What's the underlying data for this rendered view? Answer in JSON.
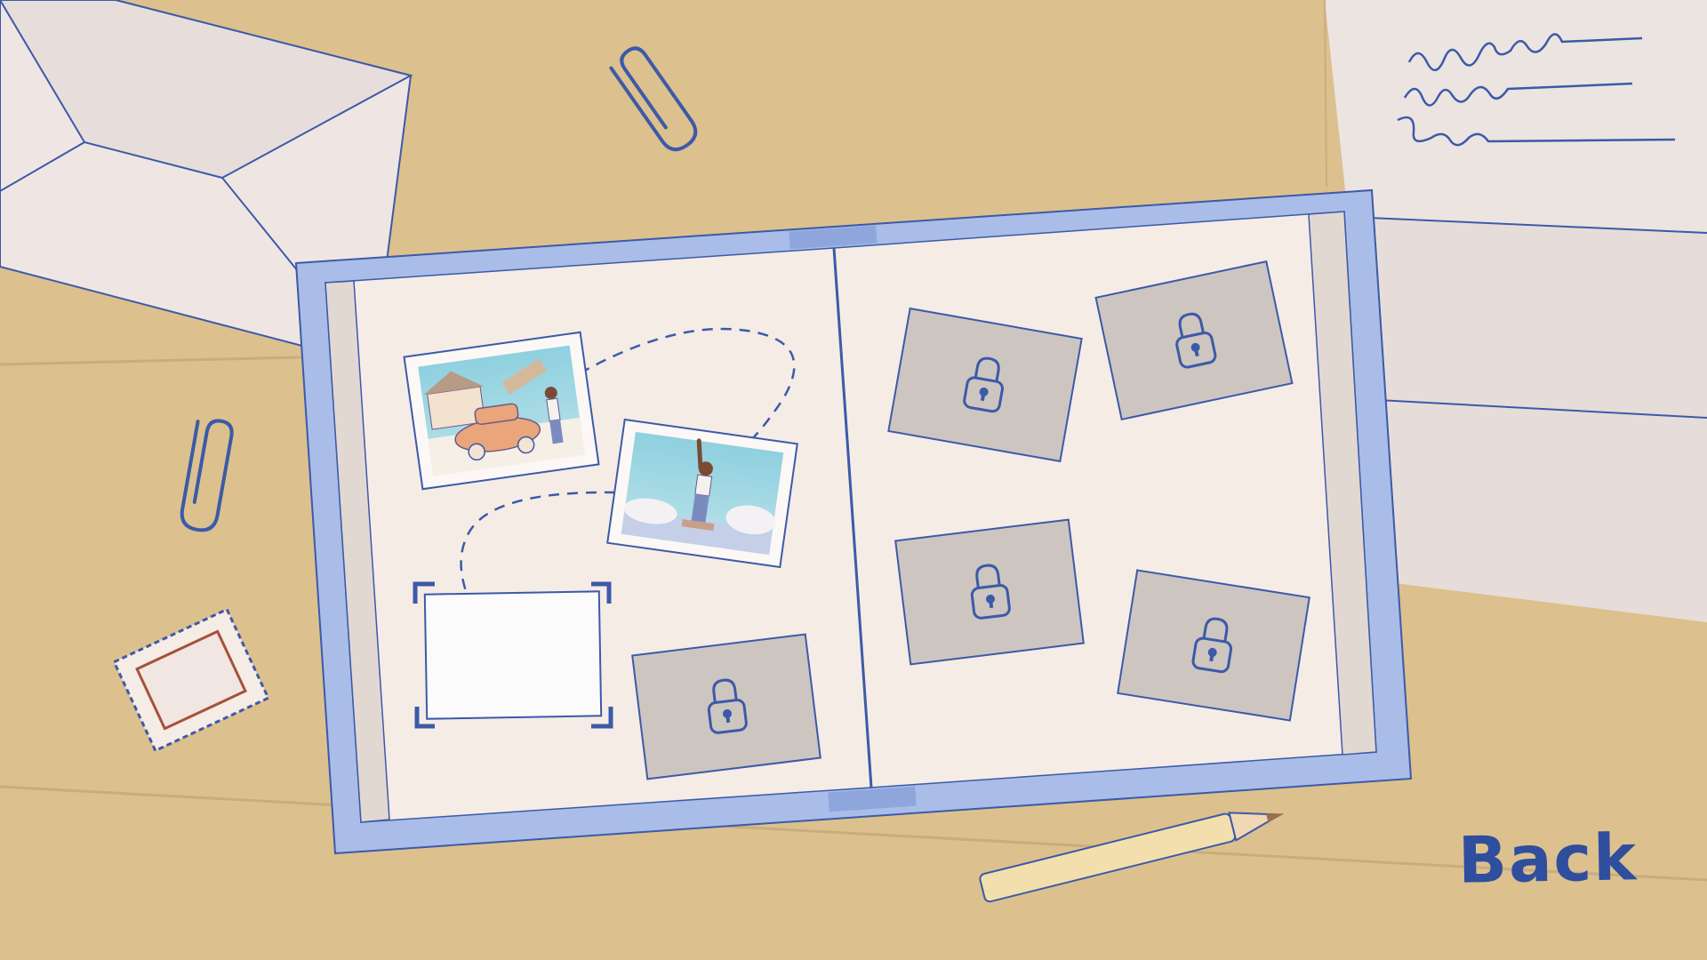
{
  "scene": {
    "name": "photo-album-desk",
    "palette": {
      "desk": "#dcc08e",
      "desk_shadow": "#cbae7b",
      "paper": "#f5ece6",
      "paper_shade": "#e5dcd6",
      "ink": "#2f4e9e",
      "album_cover": "#a9bde8",
      "album_cover_dark": "#8ea6dc",
      "locked_slot": "#cdc5c0",
      "pencil_body": "#f3dfae",
      "pencil_tip": "#9b6e4e",
      "stamp_border": "#a5523a"
    }
  },
  "album": {
    "unlocked_photos": [
      {
        "id": "photo-car-trip",
        "subject": "car-roadtrip-illustration",
        "status": "unlocked"
      },
      {
        "id": "photo-statue",
        "subject": "statue-of-liberty-illustration",
        "status": "unlocked"
      }
    ],
    "current_slot": {
      "id": "slot-next",
      "status": "empty-selected"
    },
    "locked_slots": [
      {
        "id": "locked-1",
        "status": "locked"
      },
      {
        "id": "locked-2",
        "status": "locked"
      },
      {
        "id": "locked-3",
        "status": "locked"
      },
      {
        "id": "locked-4",
        "status": "locked"
      },
      {
        "id": "locked-5",
        "status": "locked"
      }
    ]
  },
  "ui": {
    "back_label": "Back"
  }
}
